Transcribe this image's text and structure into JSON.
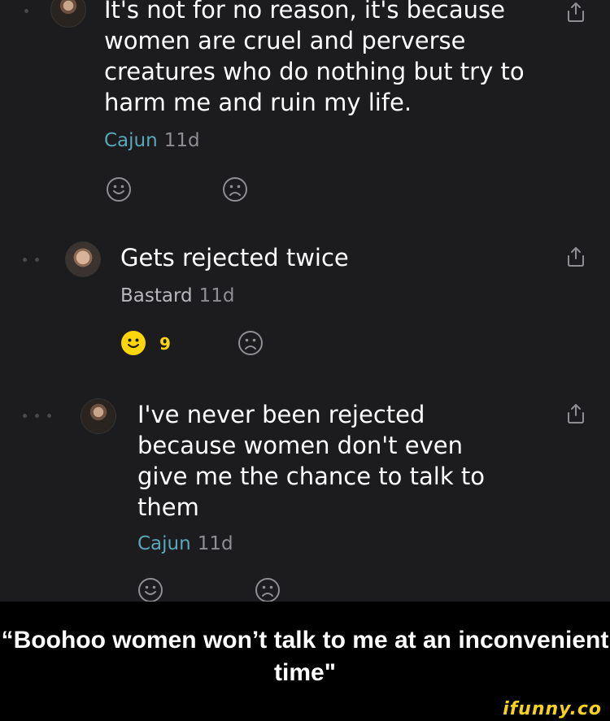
{
  "comments": [
    {
      "text": "It's not for no reason, it's because women are cruel and perverse creatures who do nothing but try to harm me and ruin my life.",
      "author": "Cajun",
      "age": "11d"
    },
    {
      "text": "Gets rejected twice",
      "author": "Bastard",
      "age": "11d",
      "smile_count": "9"
    },
    {
      "text": "I've never been rejected because women don't even give me the chance to talk to them",
      "author": "Cajun",
      "age": "11d"
    }
  ],
  "caption": "“Boohoo women won’t talk to me at an inconvenient time\"",
  "watermark": "ifunny.co",
  "colors": {
    "background": "#1c1c1e",
    "author_accent": "#5aa7b9",
    "reaction_active": "#ffd60a",
    "watermark": "#f6d21a"
  }
}
